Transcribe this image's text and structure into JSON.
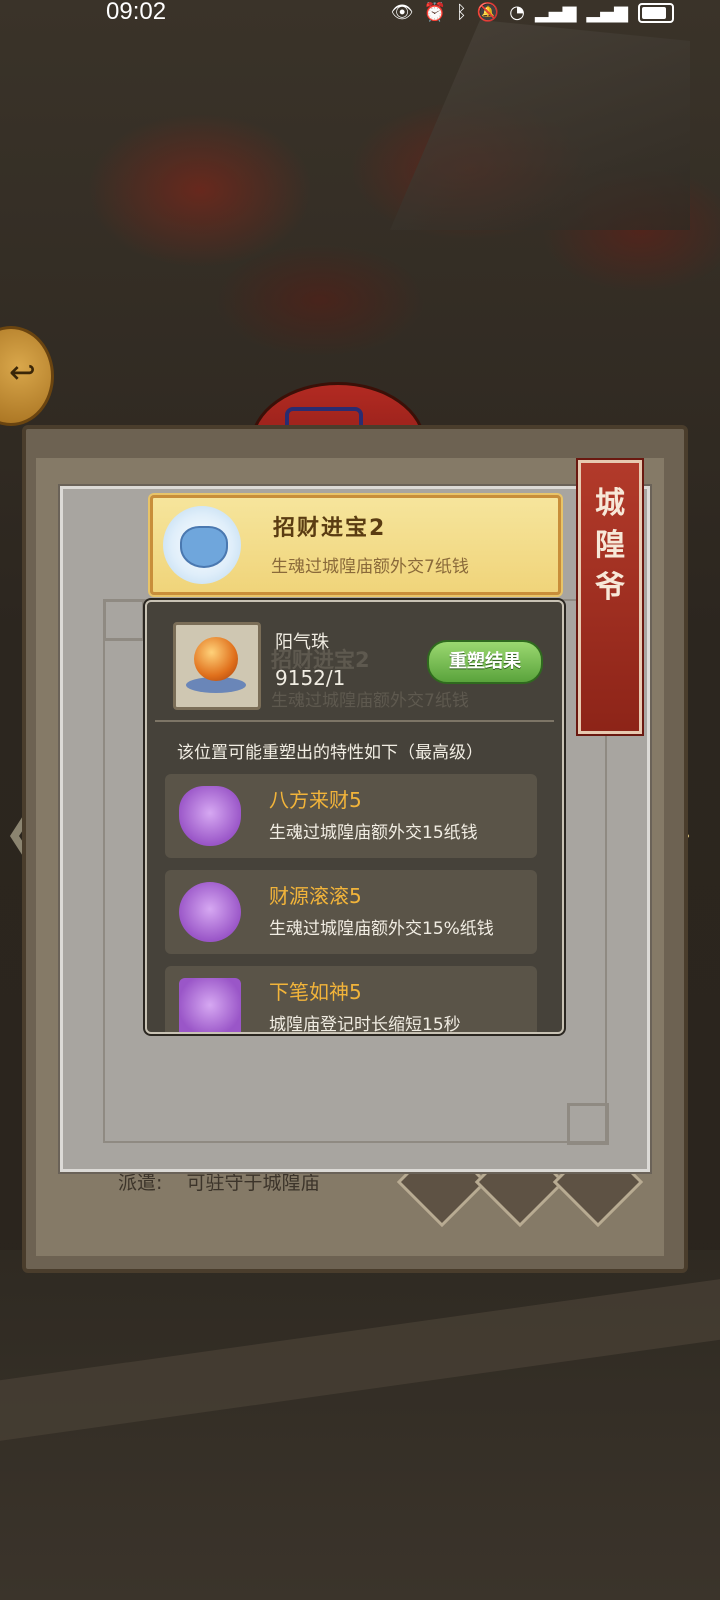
{
  "status_bar": {
    "time": "09:02",
    "icons": [
      "eye-icon",
      "alarm-icon",
      "bluetooth-icon",
      "mute-icon",
      "wifi-icon",
      "signal-5g-icon",
      "signal-4g-icon",
      "battery-icon"
    ]
  },
  "colors": {
    "accent_gold": "#f2b43a",
    "button_green": "#5aa33c",
    "banner_red": "#8d2418"
  },
  "back_panel": {
    "dispatch_label": "派遣:",
    "dispatch_value": "可驻守于城隍庙"
  },
  "side_banner": {
    "text": "城隍爷"
  },
  "header_card": {
    "title": "招财进宝2",
    "description": "生魂过城隍庙额外交7纸钱"
  },
  "popup": {
    "item_name": "阳气珠",
    "item_count": "9152/1",
    "reshape_button": "重塑结果",
    "ghost_title": "招财进宝2",
    "ghost_desc": "生魂过城隍庙额外交7纸钱",
    "hint": "该位置可能重塑出的特性如下（最高级）",
    "traits": [
      {
        "name": "八方来财5",
        "desc": "生魂过城隍庙额外交15纸钱"
      },
      {
        "name": "财源滚滚5",
        "desc": "生魂过城隍庙额外交15%纸钱"
      },
      {
        "name": "下笔如神5",
        "desc": "城隍庙登记时长缩短15秒"
      }
    ]
  }
}
